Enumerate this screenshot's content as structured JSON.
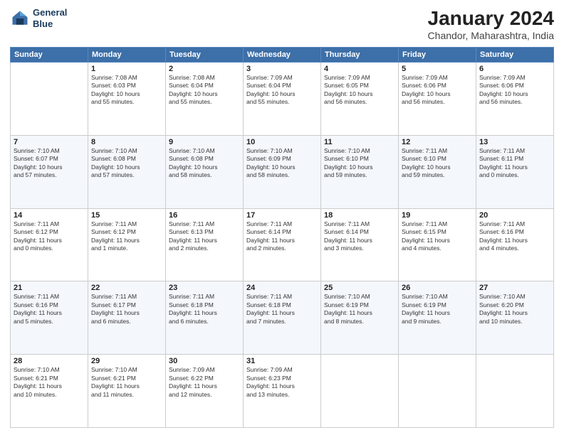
{
  "header": {
    "logo_line1": "General",
    "logo_line2": "Blue",
    "title": "January 2024",
    "subtitle": "Chandor, Maharashtra, India"
  },
  "weekdays": [
    "Sunday",
    "Monday",
    "Tuesday",
    "Wednesday",
    "Thursday",
    "Friday",
    "Saturday"
  ],
  "weeks": [
    [
      {
        "num": "",
        "info": ""
      },
      {
        "num": "1",
        "info": "Sunrise: 7:08 AM\nSunset: 6:03 PM\nDaylight: 10 hours\nand 55 minutes."
      },
      {
        "num": "2",
        "info": "Sunrise: 7:08 AM\nSunset: 6:04 PM\nDaylight: 10 hours\nand 55 minutes."
      },
      {
        "num": "3",
        "info": "Sunrise: 7:09 AM\nSunset: 6:04 PM\nDaylight: 10 hours\nand 55 minutes."
      },
      {
        "num": "4",
        "info": "Sunrise: 7:09 AM\nSunset: 6:05 PM\nDaylight: 10 hours\nand 56 minutes."
      },
      {
        "num": "5",
        "info": "Sunrise: 7:09 AM\nSunset: 6:06 PM\nDaylight: 10 hours\nand 56 minutes."
      },
      {
        "num": "6",
        "info": "Sunrise: 7:09 AM\nSunset: 6:06 PM\nDaylight: 10 hours\nand 56 minutes."
      }
    ],
    [
      {
        "num": "7",
        "info": "Sunrise: 7:10 AM\nSunset: 6:07 PM\nDaylight: 10 hours\nand 57 minutes."
      },
      {
        "num": "8",
        "info": "Sunrise: 7:10 AM\nSunset: 6:08 PM\nDaylight: 10 hours\nand 57 minutes."
      },
      {
        "num": "9",
        "info": "Sunrise: 7:10 AM\nSunset: 6:08 PM\nDaylight: 10 hours\nand 58 minutes."
      },
      {
        "num": "10",
        "info": "Sunrise: 7:10 AM\nSunset: 6:09 PM\nDaylight: 10 hours\nand 58 minutes."
      },
      {
        "num": "11",
        "info": "Sunrise: 7:10 AM\nSunset: 6:10 PM\nDaylight: 10 hours\nand 59 minutes."
      },
      {
        "num": "12",
        "info": "Sunrise: 7:11 AM\nSunset: 6:10 PM\nDaylight: 10 hours\nand 59 minutes."
      },
      {
        "num": "13",
        "info": "Sunrise: 7:11 AM\nSunset: 6:11 PM\nDaylight: 11 hours\nand 0 minutes."
      }
    ],
    [
      {
        "num": "14",
        "info": "Sunrise: 7:11 AM\nSunset: 6:12 PM\nDaylight: 11 hours\nand 0 minutes."
      },
      {
        "num": "15",
        "info": "Sunrise: 7:11 AM\nSunset: 6:12 PM\nDaylight: 11 hours\nand 1 minute."
      },
      {
        "num": "16",
        "info": "Sunrise: 7:11 AM\nSunset: 6:13 PM\nDaylight: 11 hours\nand 2 minutes."
      },
      {
        "num": "17",
        "info": "Sunrise: 7:11 AM\nSunset: 6:14 PM\nDaylight: 11 hours\nand 2 minutes."
      },
      {
        "num": "18",
        "info": "Sunrise: 7:11 AM\nSunset: 6:14 PM\nDaylight: 11 hours\nand 3 minutes."
      },
      {
        "num": "19",
        "info": "Sunrise: 7:11 AM\nSunset: 6:15 PM\nDaylight: 11 hours\nand 4 minutes."
      },
      {
        "num": "20",
        "info": "Sunrise: 7:11 AM\nSunset: 6:16 PM\nDaylight: 11 hours\nand 4 minutes."
      }
    ],
    [
      {
        "num": "21",
        "info": "Sunrise: 7:11 AM\nSunset: 6:16 PM\nDaylight: 11 hours\nand 5 minutes."
      },
      {
        "num": "22",
        "info": "Sunrise: 7:11 AM\nSunset: 6:17 PM\nDaylight: 11 hours\nand 6 minutes."
      },
      {
        "num": "23",
        "info": "Sunrise: 7:11 AM\nSunset: 6:18 PM\nDaylight: 11 hours\nand 6 minutes."
      },
      {
        "num": "24",
        "info": "Sunrise: 7:11 AM\nSunset: 6:18 PM\nDaylight: 11 hours\nand 7 minutes."
      },
      {
        "num": "25",
        "info": "Sunrise: 7:10 AM\nSunset: 6:19 PM\nDaylight: 11 hours\nand 8 minutes."
      },
      {
        "num": "26",
        "info": "Sunrise: 7:10 AM\nSunset: 6:19 PM\nDaylight: 11 hours\nand 9 minutes."
      },
      {
        "num": "27",
        "info": "Sunrise: 7:10 AM\nSunset: 6:20 PM\nDaylight: 11 hours\nand 10 minutes."
      }
    ],
    [
      {
        "num": "28",
        "info": "Sunrise: 7:10 AM\nSunset: 6:21 PM\nDaylight: 11 hours\nand 10 minutes."
      },
      {
        "num": "29",
        "info": "Sunrise: 7:10 AM\nSunset: 6:21 PM\nDaylight: 11 hours\nand 11 minutes."
      },
      {
        "num": "30",
        "info": "Sunrise: 7:09 AM\nSunset: 6:22 PM\nDaylight: 11 hours\nand 12 minutes."
      },
      {
        "num": "31",
        "info": "Sunrise: 7:09 AM\nSunset: 6:23 PM\nDaylight: 11 hours\nand 13 minutes."
      },
      {
        "num": "",
        "info": ""
      },
      {
        "num": "",
        "info": ""
      },
      {
        "num": "",
        "info": ""
      }
    ]
  ]
}
